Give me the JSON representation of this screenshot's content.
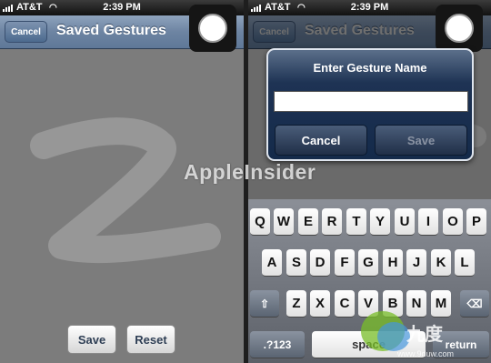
{
  "status_bar": {
    "carrier": "AT&T",
    "time": "2:39 PM",
    "wifi_icon": "wifi-icon"
  },
  "left_screen": {
    "nav_cancel": "Cancel",
    "nav_title": "Saved Gestures",
    "save_label": "Save",
    "reset_label": "Reset"
  },
  "right_screen": {
    "nav_cancel": "Cancel",
    "nav_title": "Saved Gestures",
    "alert": {
      "title": "Enter Gesture Name",
      "input_value": "",
      "cancel_label": "Cancel",
      "save_label": "Save"
    },
    "keyboard": {
      "row1": [
        "Q",
        "W",
        "E",
        "R",
        "T",
        "Y",
        "U",
        "I",
        "O",
        "P"
      ],
      "row2": [
        "A",
        "S",
        "D",
        "F",
        "G",
        "H",
        "J",
        "K",
        "L"
      ],
      "row3": [
        "Z",
        "X",
        "C",
        "V",
        "B",
        "N",
        "M"
      ],
      "numbers_label": ".?123",
      "space_label": "space",
      "return_label": "return",
      "shift_icon": "shift-icon",
      "backspace_icon": "backspace-icon"
    }
  },
  "watermark": "AppleInsider",
  "logo_text": "www.9duw.com",
  "colors": {
    "nav_blue": "#6d84a2",
    "alert_navy": "#142a4a"
  }
}
